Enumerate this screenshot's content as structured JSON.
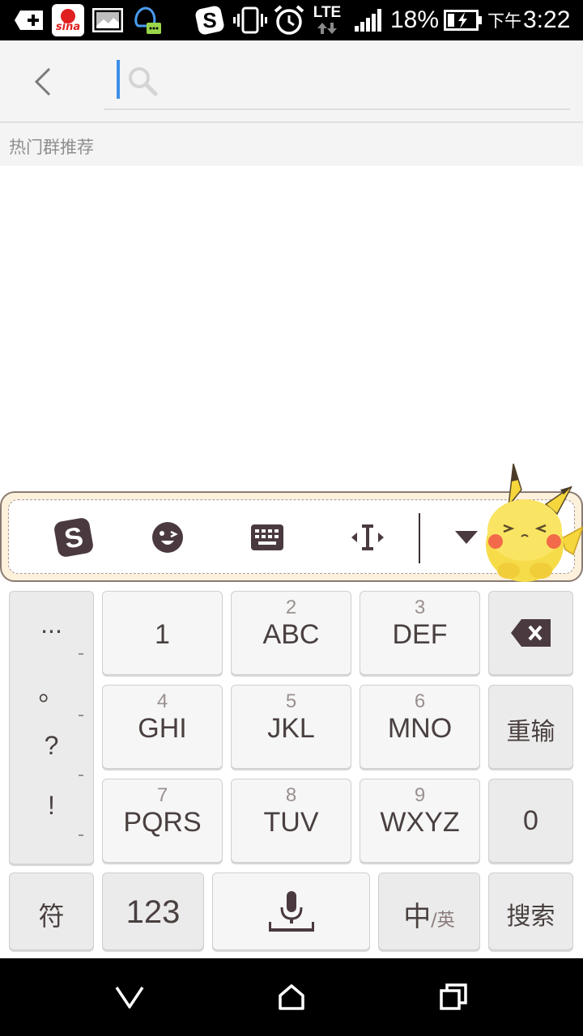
{
  "status_bar": {
    "icons": [
      "add-icon",
      "sina-weibo-icon",
      "image-icon",
      "qq-icon",
      "sogou-icon",
      "vibrate-icon",
      "alarm-icon",
      "lte-icon",
      "signal-icon",
      "battery-icon"
    ],
    "network": "LTE",
    "battery": "18%",
    "ampm": "下午",
    "time": "3:22"
  },
  "header": {
    "back_icon": "chevron-left-icon",
    "search_icon": "search-icon",
    "search_value": "",
    "search_placeholder": ""
  },
  "section": {
    "title": "热门群推荐"
  },
  "keyboard": {
    "toolbar_icons": [
      "sogou-logo-icon",
      "emoji-icon",
      "keyboard-icon",
      "cursor-move-icon",
      "collapse-keyboard-icon"
    ],
    "punctuation": [
      "...",
      "。",
      "?",
      "!"
    ],
    "keys": [
      {
        "sub": "",
        "main": "1"
      },
      {
        "sub": "2",
        "main": "ABC"
      },
      {
        "sub": "3",
        "main": "DEF"
      },
      {
        "sub": "4",
        "main": "GHI"
      },
      {
        "sub": "5",
        "main": "JKL"
      },
      {
        "sub": "6",
        "main": "MNO"
      },
      {
        "sub": "7",
        "main": "PQRS"
      },
      {
        "sub": "8",
        "main": "TUV"
      },
      {
        "sub": "9",
        "main": "WXYZ"
      }
    ],
    "right_keys": {
      "backspace_icon": "backspace-icon",
      "reinput": "重输",
      "zero": "0"
    },
    "bottom_row": {
      "symbols": "符",
      "numbers": "123",
      "space_icon": "microphone-icon",
      "lang_main": "中",
      "lang_sub": "/英",
      "search": "搜索"
    }
  },
  "nav_bar": {
    "icons": [
      "back-nav-icon",
      "home-icon",
      "recent-apps-icon"
    ]
  },
  "colors": {
    "status_bar": "#000000",
    "header_bg": "#f4f4f4",
    "cursor": "#3d8fe8",
    "key_text": "#4a4040",
    "candidate_bg": "#fdf1dc",
    "icon_dark": "#4a3a3f"
  }
}
